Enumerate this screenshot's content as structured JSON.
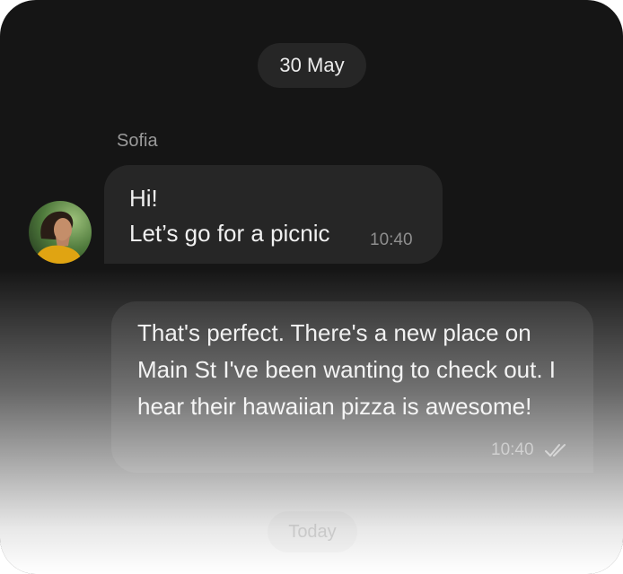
{
  "chat": {
    "date_separator": "30 May",
    "today_separator": "Today",
    "incoming": {
      "sender": "Sofia",
      "line1": "Hi!",
      "line2": "Let’s go for a picnic",
      "time": "10:40",
      "avatar_icon": "person-avatar-icon"
    },
    "outgoing": {
      "text": "That's perfect. There's a new place on Main St I've been wanting to check out. I hear their hawaiian pizza is awesome!",
      "time": "10:40",
      "status_icon": "double-check-icon"
    }
  },
  "colors": {
    "background": "#151515",
    "bubble": "#262626",
    "text": "#eeeeee",
    "muted": "#8e8e8e"
  }
}
